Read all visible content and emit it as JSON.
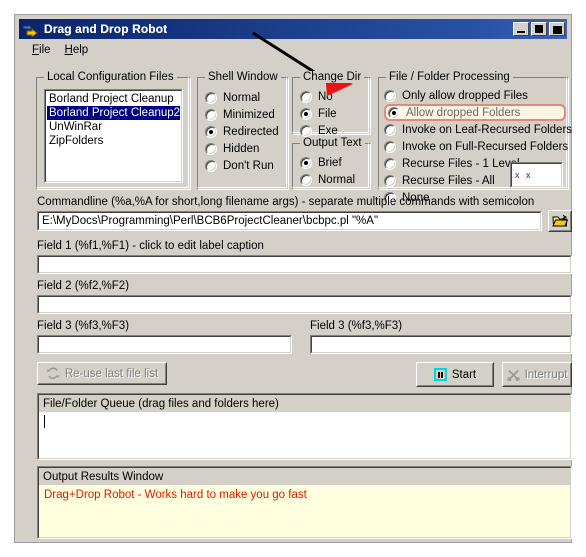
{
  "window": {
    "title": "Drag and Drop Robot",
    "icon": "drag-drop-arrow-icon",
    "buttons": {
      "minimize": "_",
      "maximize": "□",
      "close": "×"
    }
  },
  "menu": {
    "items": [
      "File",
      "Help"
    ]
  },
  "groups": {
    "local_config": {
      "title": "Local Configuration Files",
      "items": [
        {
          "label": "Borland Project Cleanup",
          "selected": false
        },
        {
          "label": "Borland Project Cleanup2",
          "selected": true
        },
        {
          "label": "UnWinRar",
          "selected": false
        },
        {
          "label": "ZipFolders",
          "selected": false
        }
      ]
    },
    "shell_window": {
      "title": "Shell Window",
      "options": [
        {
          "label": "Normal",
          "selected": false
        },
        {
          "label": "Minimized",
          "selected": false
        },
        {
          "label": "Redirected",
          "selected": true
        },
        {
          "label": "Hidden",
          "selected": false
        },
        {
          "label": "Don't Run",
          "selected": false
        }
      ]
    },
    "change_dir": {
      "title": "Change Dir",
      "options": [
        {
          "label": "No",
          "selected": false
        },
        {
          "label": "File",
          "selected": true
        },
        {
          "label": "Exe",
          "selected": false
        }
      ]
    },
    "output_text": {
      "title": "Output Text",
      "options": [
        {
          "label": "Brief",
          "selected": true
        },
        {
          "label": "Normal",
          "selected": false
        }
      ]
    },
    "file_folder_processing": {
      "title": "File / Folder Processing",
      "options": [
        {
          "label": "Only allow dropped Files",
          "selected": false,
          "highlighted": false
        },
        {
          "label": "Allow dropped Folders",
          "selected": true,
          "highlighted": true
        },
        {
          "label": "Invoke on Leaf-Recursed Folders",
          "selected": false,
          "highlighted": false
        },
        {
          "label": "Invoke on Full-Recursed Folders",
          "selected": false,
          "highlighted": false
        },
        {
          "label": "Recurse Files - 1 Level",
          "selected": false,
          "highlighted": false
        },
        {
          "label": "Recurse Files - All",
          "selected": false,
          "highlighted": false
        },
        {
          "label": "None",
          "selected": false,
          "highlighted": false
        }
      ],
      "mask_box_value": "x x"
    }
  },
  "commandline": {
    "label": "Commandline (%a,%A for short,long filename args) - separate multiple commands with semicolon",
    "value": "E:\\MyDocs\\Programming\\Perl\\BCB6ProjectCleaner\\bcbpc.pl \"%A\"",
    "browse_icon": "open-folder-icon"
  },
  "fields": [
    {
      "label": "Field 1 (%f1,%F1) - click to edit label caption",
      "value": ""
    },
    {
      "label": "Field 2 (%f2,%F2)",
      "value": ""
    },
    {
      "label": "Field 3 (%f3,%F3)",
      "value": ""
    },
    {
      "label": "Field 3 (%f3,%F3)",
      "value": ""
    }
  ],
  "actions": {
    "reuse": {
      "label": "Re-use last file list",
      "icon": "recycle-icon",
      "disabled": true
    },
    "start": {
      "label": "Start",
      "icon": "start-square-icon",
      "disabled": false
    },
    "interrupt": {
      "label": "Interrupt",
      "icon": "scissors-icon",
      "disabled": true
    }
  },
  "queue": {
    "header": "File/Folder Queue (drag files and folders here)",
    "value": ""
  },
  "output": {
    "header": "Output Results Window",
    "text": "Drag+Drop Robot - Works hard to make you go fast",
    "text_color": "#d81e00",
    "background": "#ffffe0"
  },
  "annotation": {
    "arrow_color": "#ee1111",
    "line_color": "#000000",
    "highlight_color": "#e8857c"
  }
}
